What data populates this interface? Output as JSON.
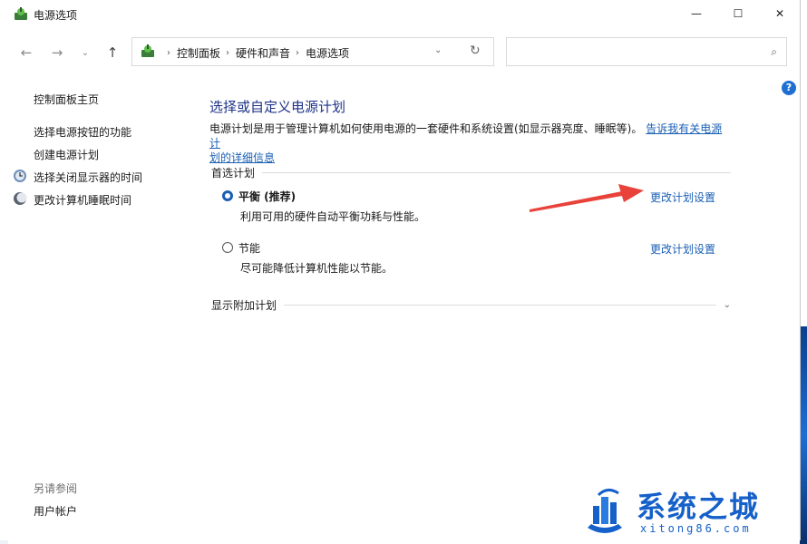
{
  "window": {
    "title": "电源选项",
    "min_glyph": "—",
    "max_glyph": "☐",
    "close_glyph": "✕"
  },
  "nav": {
    "back_glyph": "←",
    "forward_glyph": "→",
    "recent_glyph": "⌄",
    "up_glyph": "↑",
    "breadcrumbs": [
      "控制面板",
      "硬件和声音",
      "电源选项"
    ],
    "crumb_sep": "›",
    "dropdown_glyph": "⌄",
    "refresh_glyph": "↻",
    "search_placeholder": "",
    "search_glyph": "⌕"
  },
  "help_glyph": "?",
  "sidebar": {
    "home": "控制面板主页",
    "items": [
      {
        "label": "选择电源按钮的功能",
        "icon": "none"
      },
      {
        "label": "创建电源计划",
        "icon": "none"
      },
      {
        "label": "选择关闭显示器的时间",
        "icon": "monitor-icon"
      },
      {
        "label": "更改计算机睡眠时间",
        "icon": "moon-icon"
      }
    ],
    "see_also_title": "另请参阅",
    "see_also_items": [
      "用户帐户"
    ]
  },
  "main": {
    "title": "选择或自定义电源计划",
    "desc_text": "电源计划是用于管理计算机如何使用电源的一套硬件和系统设置(如显示器亮度、睡眠等)。",
    "desc_link_part1": "告诉我有关电源计",
    "desc_link_part2": "划的详细信息",
    "preferred_section": "首选计划",
    "plans": [
      {
        "name": "平衡 (推荐)",
        "desc": "利用可用的硬件自动平衡功耗与性能。",
        "selected": true,
        "link": "更改计划设置"
      },
      {
        "name": "节能",
        "desc": "尽可能降低计算机性能以节能。",
        "selected": false,
        "link": "更改计划设置"
      }
    ],
    "more_section": "显示附加计划",
    "more_chevron": "⌄"
  },
  "colors": {
    "accent": "#1a5fb4",
    "title_blue": "#1e3287",
    "arrow_red": "#e8423b"
  },
  "watermark": {
    "text": "系统之城",
    "sub": "xitong86.com"
  }
}
